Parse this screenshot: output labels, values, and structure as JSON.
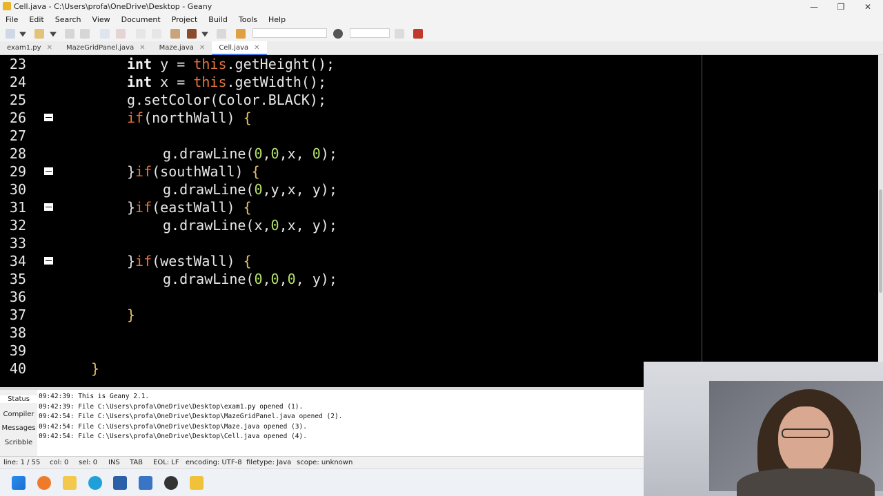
{
  "window": {
    "title": "Cell.java - C:\\Users\\profa\\OneDrive\\Desktop - Geany",
    "minimize": "—",
    "maximize": "❐",
    "close": "✕"
  },
  "menu": [
    "File",
    "Edit",
    "Search",
    "View",
    "Document",
    "Project",
    "Build",
    "Tools",
    "Help"
  ],
  "tabs": [
    {
      "label": "exam1.py",
      "close": "✕"
    },
    {
      "label": "MazeGridPanel.java",
      "close": "✕"
    },
    {
      "label": "Maze.java",
      "close": "✕"
    },
    {
      "label": "Cell.java",
      "close": "✕"
    }
  ],
  "editor": {
    "lines": [
      {
        "n": "23",
        "fold": false
      },
      {
        "n": "24",
        "fold": false
      },
      {
        "n": "25",
        "fold": false
      },
      {
        "n": "26",
        "fold": true
      },
      {
        "n": "27",
        "fold": false
      },
      {
        "n": "28",
        "fold": false
      },
      {
        "n": "29",
        "fold": true
      },
      {
        "n": "30",
        "fold": false
      },
      {
        "n": "31",
        "fold": true
      },
      {
        "n": "32",
        "fold": false
      },
      {
        "n": "33",
        "fold": false
      },
      {
        "n": "34",
        "fold": true
      },
      {
        "n": "35",
        "fold": false
      },
      {
        "n": "36",
        "fold": false
      },
      {
        "n": "37",
        "fold": false
      },
      {
        "n": "38",
        "fold": false
      },
      {
        "n": "39",
        "fold": false
      },
      {
        "n": "40",
        "fold": false
      }
    ],
    "code": {
      "l23_kw": "int",
      "l23_rest": " y = ",
      "l23_this": "this",
      "l23_tail": ".getHeight();",
      "l24_kw": "int",
      "l24_rest": " x = ",
      "l24_this": "this",
      "l24_tail": ".getWidth();",
      "l25": "g.setColor(Color.BLACK);",
      "l26_if": "if",
      "l26_cond": "(northWall) ",
      "l26_br": "{",
      "l28": "g.drawLine(",
      "l28_a": "0",
      "l28_b": ",",
      "l28_c": "0",
      "l28_d": ",x, ",
      "l28_e": "0",
      "l28_f": ");",
      "l29_close": "}",
      "l29_if": "if",
      "l29_cond": "(southWall) ",
      "l29_br": "{",
      "l30": "g.drawLine(",
      "l30_a": "0",
      "l30_rest": ",y,x, y);",
      "l31_close": "}",
      "l31_if": "if",
      "l31_cond": "(eastWall) ",
      "l31_br": "{",
      "l32": "g.drawLine(x,",
      "l32_a": "0",
      "l32_rest": ",x, y);",
      "l34_close": "}",
      "l34_if": "if",
      "l34_cond": "(westWall) ",
      "l34_br": "{",
      "l35": "g.drawLine(",
      "l35_a": "0",
      "l35_b": ",",
      "l35_c": "0",
      "l35_d": ",",
      "l35_e": "0",
      "l35_f": ", y);",
      "l37": "}",
      "l40": "}"
    }
  },
  "messages": {
    "tabs": [
      "Status",
      "Compiler",
      "Messages",
      "Scribble"
    ],
    "lines": [
      "09:42:39: This is Geany 2.1.",
      "09:42:39: File C:\\Users\\profa\\OneDrive\\Desktop\\exam1.py opened (1).",
      "09:42:54: File C:\\Users\\profa\\OneDrive\\Desktop\\MazeGridPanel.java opened (2).",
      "09:42:54: File C:\\Users\\profa\\OneDrive\\Desktop\\Maze.java opened (3).",
      "09:42:54: File C:\\Users\\profa\\OneDrive\\Desktop\\Cell.java opened (4)."
    ]
  },
  "status": {
    "line": "line: 1 / 55",
    "col": "col: 0",
    "sel": "sel: 0",
    "ins": "INS",
    "tab": "TAB",
    "eol": "EOL: LF",
    "encoding": "encoding: UTF-8",
    "filetype": "filetype: Java",
    "scope": "scope: unknown"
  },
  "colors": {
    "editor_bg": "#000000",
    "keyword_orange": "#e8743b",
    "number_green": "#b5e06b",
    "bracket_yellow": "#e6c36a",
    "active_tab_accent": "#3f7ee6"
  }
}
